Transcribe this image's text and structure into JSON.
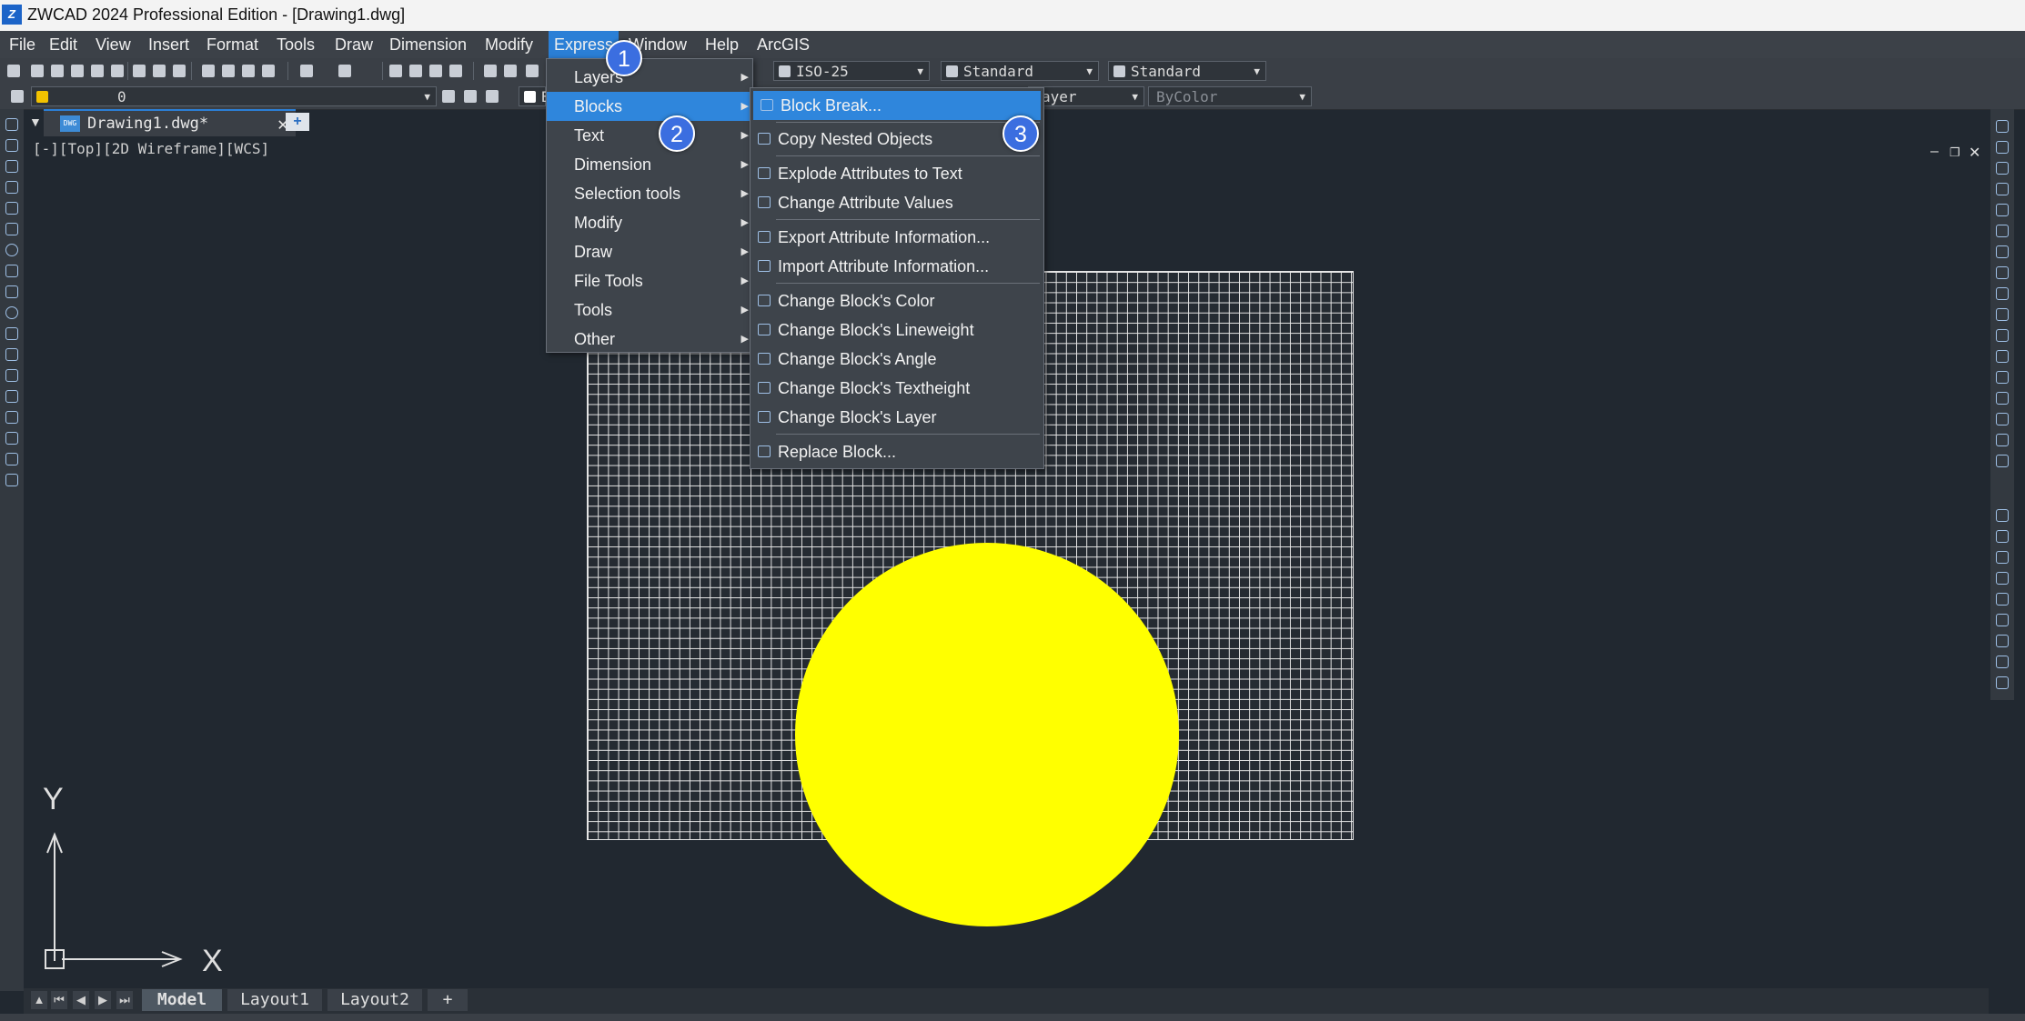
{
  "window": {
    "title": "ZWCAD 2024 Professional Edition - [Drawing1.dwg]",
    "logo_icon": "zwcad-logo-icon"
  },
  "menubar": {
    "items": [
      "File",
      "Edit",
      "View",
      "Insert",
      "Format",
      "Tools",
      "Draw",
      "Dimension",
      "Modify",
      "Express",
      "Window",
      "Help",
      "ArcGIS"
    ],
    "active": "Express"
  },
  "toolbar": {
    "dimstyle": "ISO-25",
    "tablestyle": "Standard",
    "mleaderstyle": "Standard",
    "layer": "0",
    "linetype_partial": "ayer",
    "lineweight": "ByColor",
    "color_partial": "B"
  },
  "doctab": {
    "name": "Drawing1.dwg*",
    "new_tab_icon": "new-tab-icon"
  },
  "viewport": {
    "label": "[-][Top][2D Wireframe][WCS]"
  },
  "express_menu": {
    "items": [
      "Layers",
      "Blocks",
      "Text",
      "Dimension",
      "Selection tools",
      "Modify",
      "Draw",
      "File Tools",
      "Tools",
      "Other"
    ],
    "highlighted": "Blocks"
  },
  "blocks_submenu": {
    "items": [
      "Block Break...",
      "Copy Nested Objects",
      "Explode Attributes to Text",
      "Change Attribute Values",
      "Export Attribute Information...",
      "Import Attribute Information...",
      "Change Block's Color",
      "Change Block's Lineweight",
      "Change Block's Angle",
      "Change Block's Textheight",
      "Change Block's Layer",
      "Replace Block..."
    ],
    "highlighted": "Block Break..."
  },
  "step_badges": [
    "1",
    "2",
    "3"
  ],
  "ucs": {
    "x": "X",
    "y": "Y"
  },
  "layout_tabs": [
    "Model",
    "Layout1",
    "Layout2",
    "+"
  ],
  "colors": {
    "accent": "#2f86dc",
    "canvas": "#212830",
    "circle_fill": "#ffff00",
    "badge": "#3b6ee0"
  }
}
